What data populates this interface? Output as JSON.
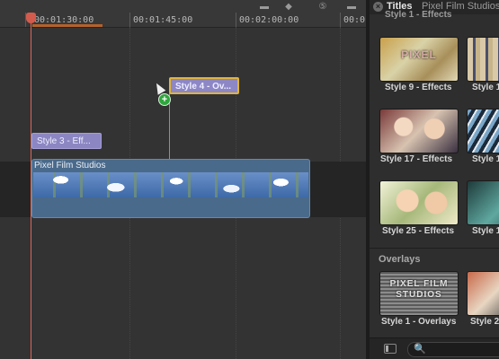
{
  "timeline": {
    "timecodes": [
      "00:01:30:00",
      "00:01:45:00",
      "00:02:00:00",
      "00:0"
    ],
    "clips": {
      "style3": "Style 3 - Eff...",
      "style4": "Style 4 - Ov...",
      "main": "Pixel Film Studios"
    }
  },
  "browser": {
    "title": "Titles",
    "subtitle": "Pixel Film Studios",
    "top_cut_label": "Style 1 - Effects",
    "thumbnails": [
      {
        "label": "Style 9 - Effects",
        "icon": "style-9-effects-thumbnail"
      },
      {
        "label": "Style 1",
        "icon": "style-effects-thumbnail"
      },
      {
        "label": "Style 17 - Effects",
        "icon": "style-17-effects-thumbnail"
      },
      {
        "label": "Style 1",
        "icon": "style-effects-thumbnail"
      },
      {
        "label": "Style 25 - Effects",
        "icon": "style-25-effects-thumbnail"
      },
      {
        "label": "Style 1",
        "icon": "style-effects-thumbnail"
      }
    ],
    "overlays_heading": "Overlays",
    "overlay_thumbnail_text": "PIXEL FILM STUDIOS",
    "overlay_thumbnails": [
      {
        "label": "Style 1 - Overlays",
        "icon": "style-1-overlays-thumbnail"
      },
      {
        "label": "Style 2",
        "icon": "style-2-overlays-thumbnail"
      }
    ],
    "search_glyph": "🔍"
  },
  "colors": {
    "playhead": "#d9675a",
    "title_clip": "#8c86c2",
    "selection": "#e0b43d",
    "video_clip": "#4a6a8c"
  }
}
